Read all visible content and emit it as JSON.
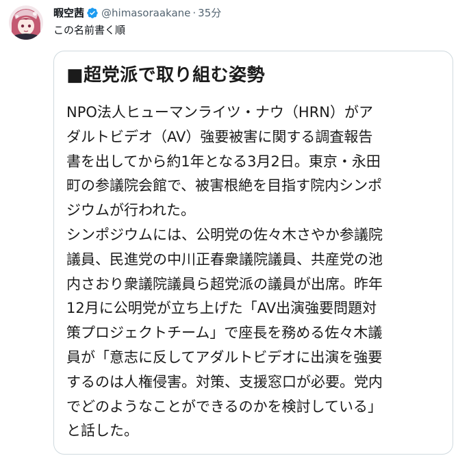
{
  "tweet": {
    "display_name": "暇空茜",
    "handle": "@himasoraakane",
    "separator": "·",
    "time": "35分",
    "text": "この名前書く順",
    "verified_icon": "verified-badge-icon",
    "colors": {
      "text": "#0f1419",
      "secondary": "#536471",
      "verified": "#1d9bf0",
      "card_border": "#cfd9de"
    }
  },
  "article": {
    "title": "■超党派で取り組む姿勢",
    "lines": [
      "NPO法人ヒューマンライツ・ナウ（HRN）がア",
      "ダルトビデオ（AV）強要被害に関する調査報告",
      "書を出してから約1年となる3月2日。東京・永田",
      "町の参議院会館で、被害根絶を目指す院内シンポ",
      "ジウムが行われた。",
      "シンポジウムには、公明党の佐々木さやか参議院",
      "議員、民進党の中川正春衆議院議員、共産党の池",
      "内さおり衆議院議員ら超党派の議員が出席。昨年",
      "12月に公明党が立ち上げた「AV出演強要問題対",
      "策プロジェクトチーム」で座長を務める佐々木議",
      "員が「意志に反してアダルトビデオに出演を強要",
      "するのは人権侵害。対策、支援窓口が必要。党内",
      "でどのようなことができるのかを検討している」",
      "と話した。"
    ]
  }
}
